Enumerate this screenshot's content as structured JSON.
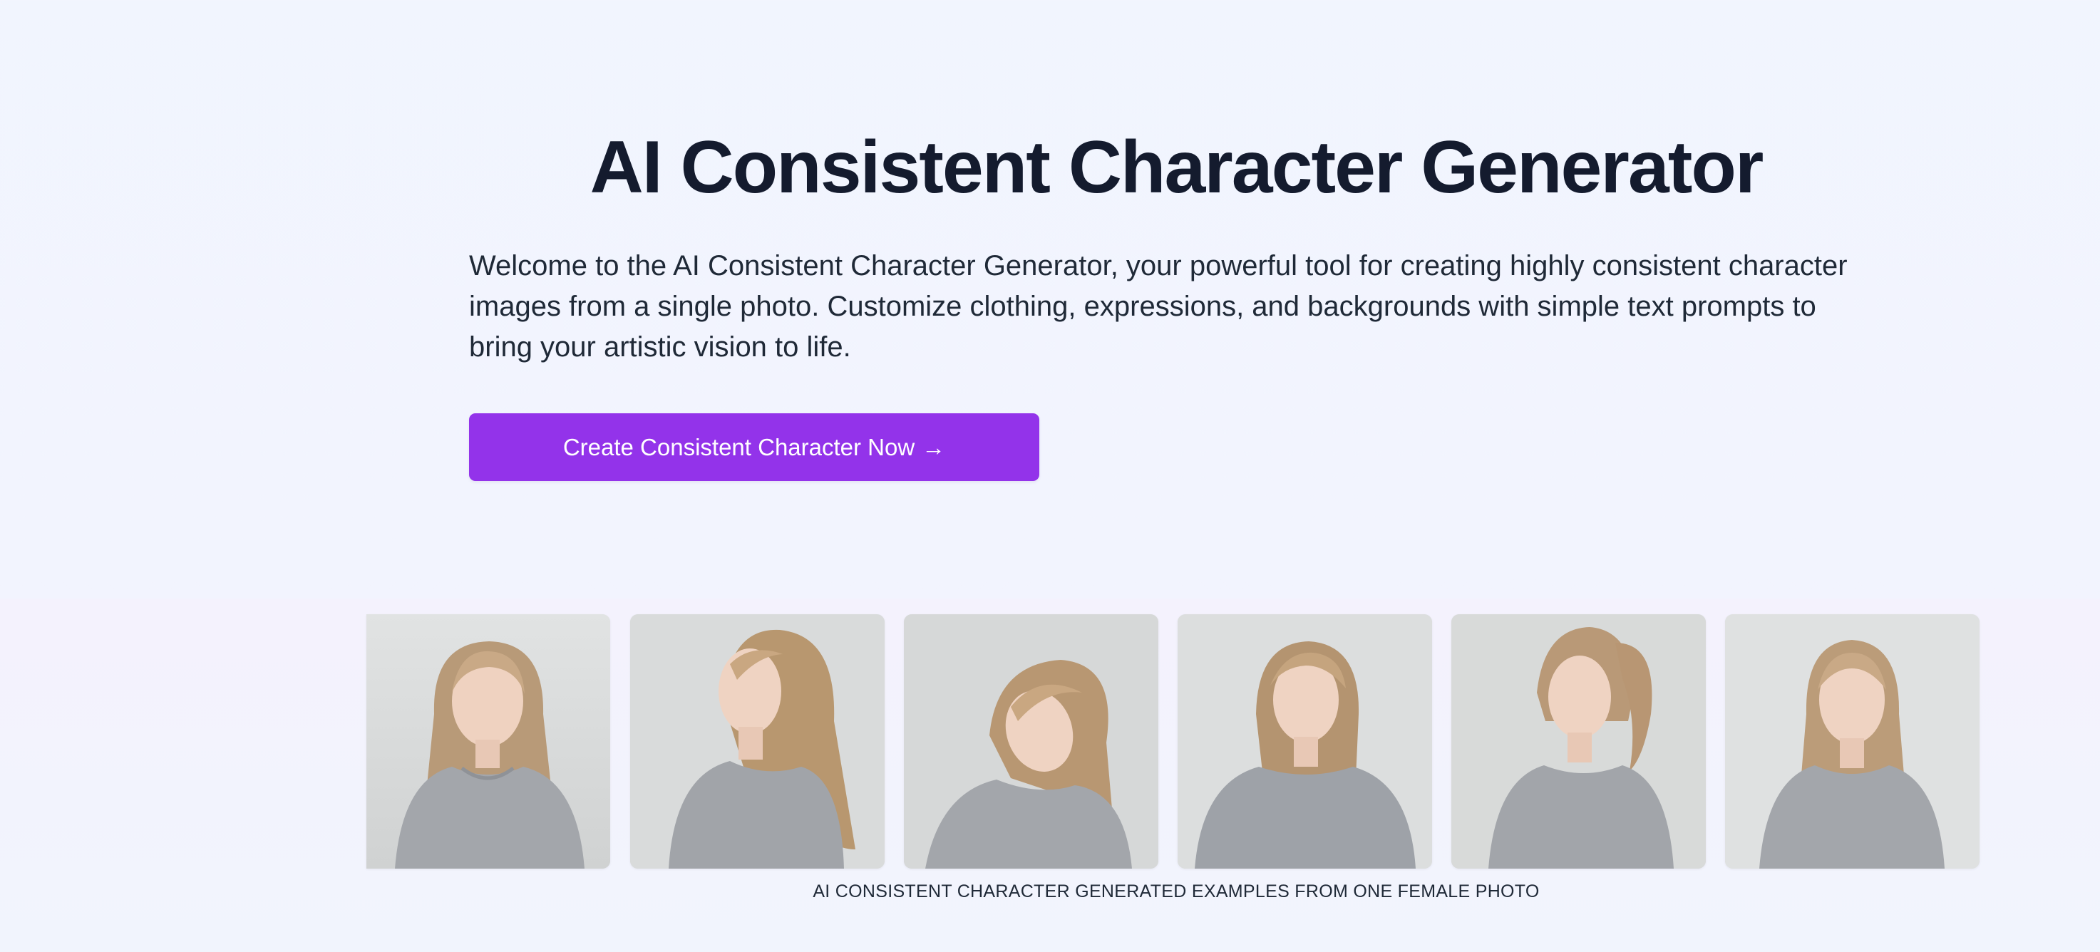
{
  "hero": {
    "title": "AI Consistent Character Generator",
    "subtitle": "Welcome to the AI Consistent Character Generator, your powerful tool for creating highly consistent character images from a single photo. Customize clothing, expressions, and backgrounds with simple text prompts to bring your artistic vision to life.",
    "cta_label": "Create Consistent Character Now",
    "cta_arrow": "→",
    "cta_color": "#9333ea"
  },
  "gallery": {
    "caption": "AI CONSISTENT CHARACTER GENERATED EXAMPLES FROM ONE FEMALE PHOTO",
    "images": [
      {
        "name": "example-portrait-1",
        "pose": "front-smile"
      },
      {
        "name": "example-portrait-2",
        "pose": "side-profile"
      },
      {
        "name": "example-portrait-3",
        "pose": "head-tilt"
      },
      {
        "name": "example-portrait-4",
        "pose": "three-quarter"
      },
      {
        "name": "example-portrait-5",
        "pose": "ponytail"
      },
      {
        "name": "example-portrait-6",
        "pose": "front-neutral"
      }
    ]
  }
}
